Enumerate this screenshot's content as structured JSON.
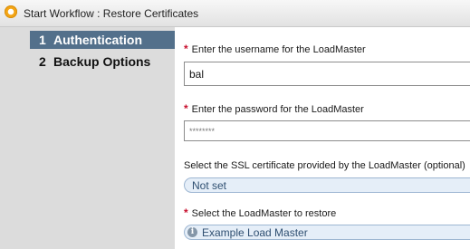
{
  "window": {
    "title": "Start Workflow : Restore Certificates",
    "icon": "workflow-icon"
  },
  "nav": {
    "items": [
      {
        "number": "1",
        "label": "Authentication",
        "active": true
      },
      {
        "number": "2",
        "label": "Backup Options",
        "active": false
      }
    ]
  },
  "form": {
    "required_marker": "*",
    "username": {
      "label": "Enter the username for the LoadMaster",
      "value": "bal"
    },
    "password": {
      "label": "Enter the password for the LoadMaster",
      "value": "********"
    },
    "ssl": {
      "label": "Select the SSL certificate provided by the LoadMaster (optional)",
      "value": "Not set"
    },
    "loadmaster": {
      "label": "Select the LoadMaster to restore",
      "value": "Example Load Master",
      "icon": "info-icon"
    }
  },
  "colors": {
    "nav_active_bg": "#53708b",
    "nav_bg": "#dcdcdc",
    "required": "#c8102e",
    "select_bg": "#e5eef8"
  }
}
